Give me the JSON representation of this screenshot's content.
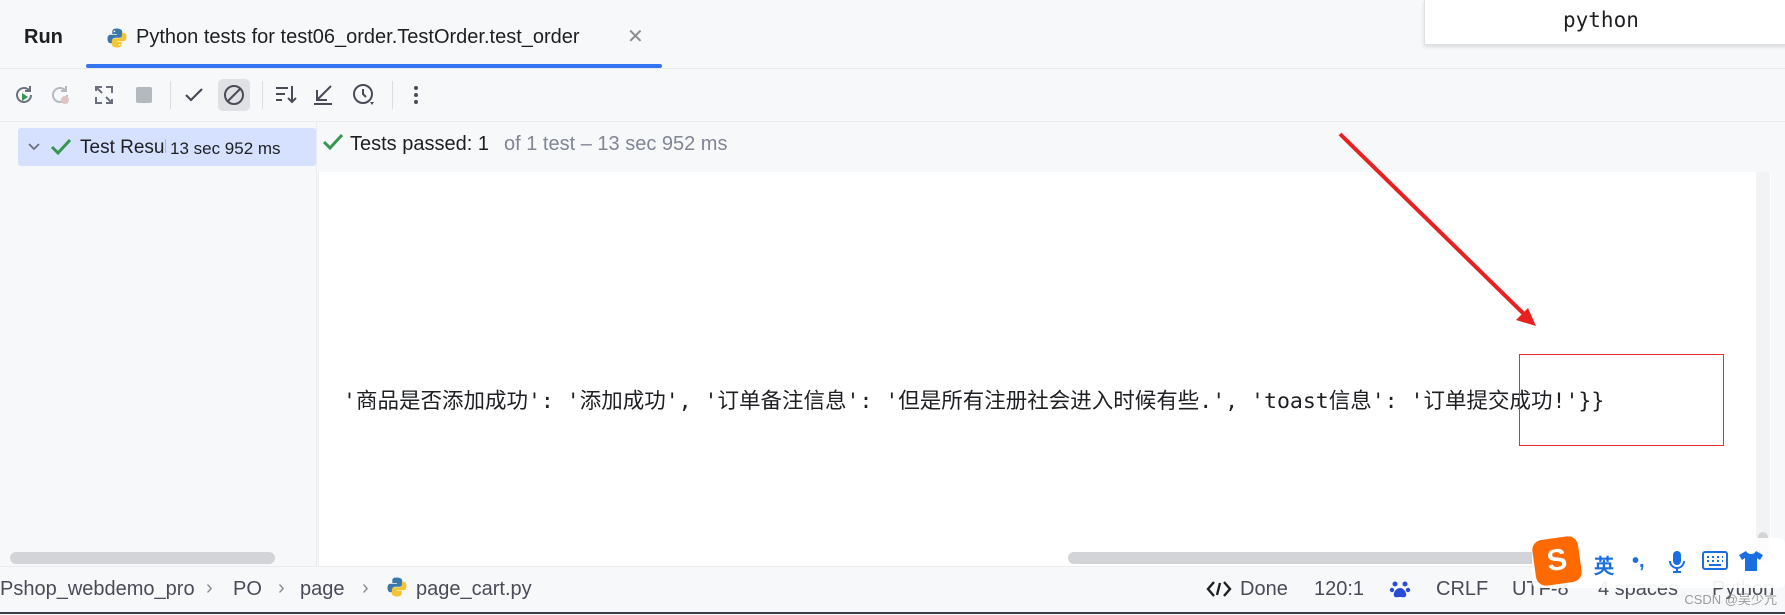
{
  "tabbar": {
    "run_label": "Run",
    "tab_label": "Python tests for test06_order.TestOrder.test_order",
    "close_glyph": "✕",
    "tab_icon": "python-test-icon",
    "popup_text": "python"
  },
  "toolbar": {
    "buttons": [
      "rerun-icon",
      "rerun-failed-icon",
      "toggle-auto-test-icon",
      "stop-icon",
      "show-passed-icon",
      "show-ignored-icon",
      "sort-icon",
      "collapse-icon",
      "history-icon",
      "more-icon"
    ]
  },
  "tree": {
    "root_label": "Test Results",
    "root_time": "13 sec 952 ms"
  },
  "summary": {
    "passed": "Tests passed: 1",
    "detail": "of 1 test – 13 sec 952 ms"
  },
  "console": {
    "line": "'商品是否添加成功': '添加成功', '订单备注信息': '但是所有注册社会进入时候有些.', 'toast信息': '订单提交成功!'}} "
  },
  "statusbar": {
    "crumbs": [
      "Pshop_webdemo_pro",
      "PO",
      "page",
      "page_cart.py"
    ],
    "separator": "›",
    "done": "Done",
    "position": "120:1",
    "line_ending": "CRLF",
    "encoding": "UTF-8",
    "indent": "4 spaces",
    "language": "Python",
    "watermark": "CSDN @吴少亢"
  },
  "ime": {
    "logo": "S",
    "items": [
      "英",
      "•,",
      "🎤",
      "⌨",
      "👕"
    ]
  },
  "colors": {
    "accent": "#3574f0",
    "pass_green": "#369650",
    "annotation_red": "#e83030",
    "selection": "#d5e1ff"
  }
}
